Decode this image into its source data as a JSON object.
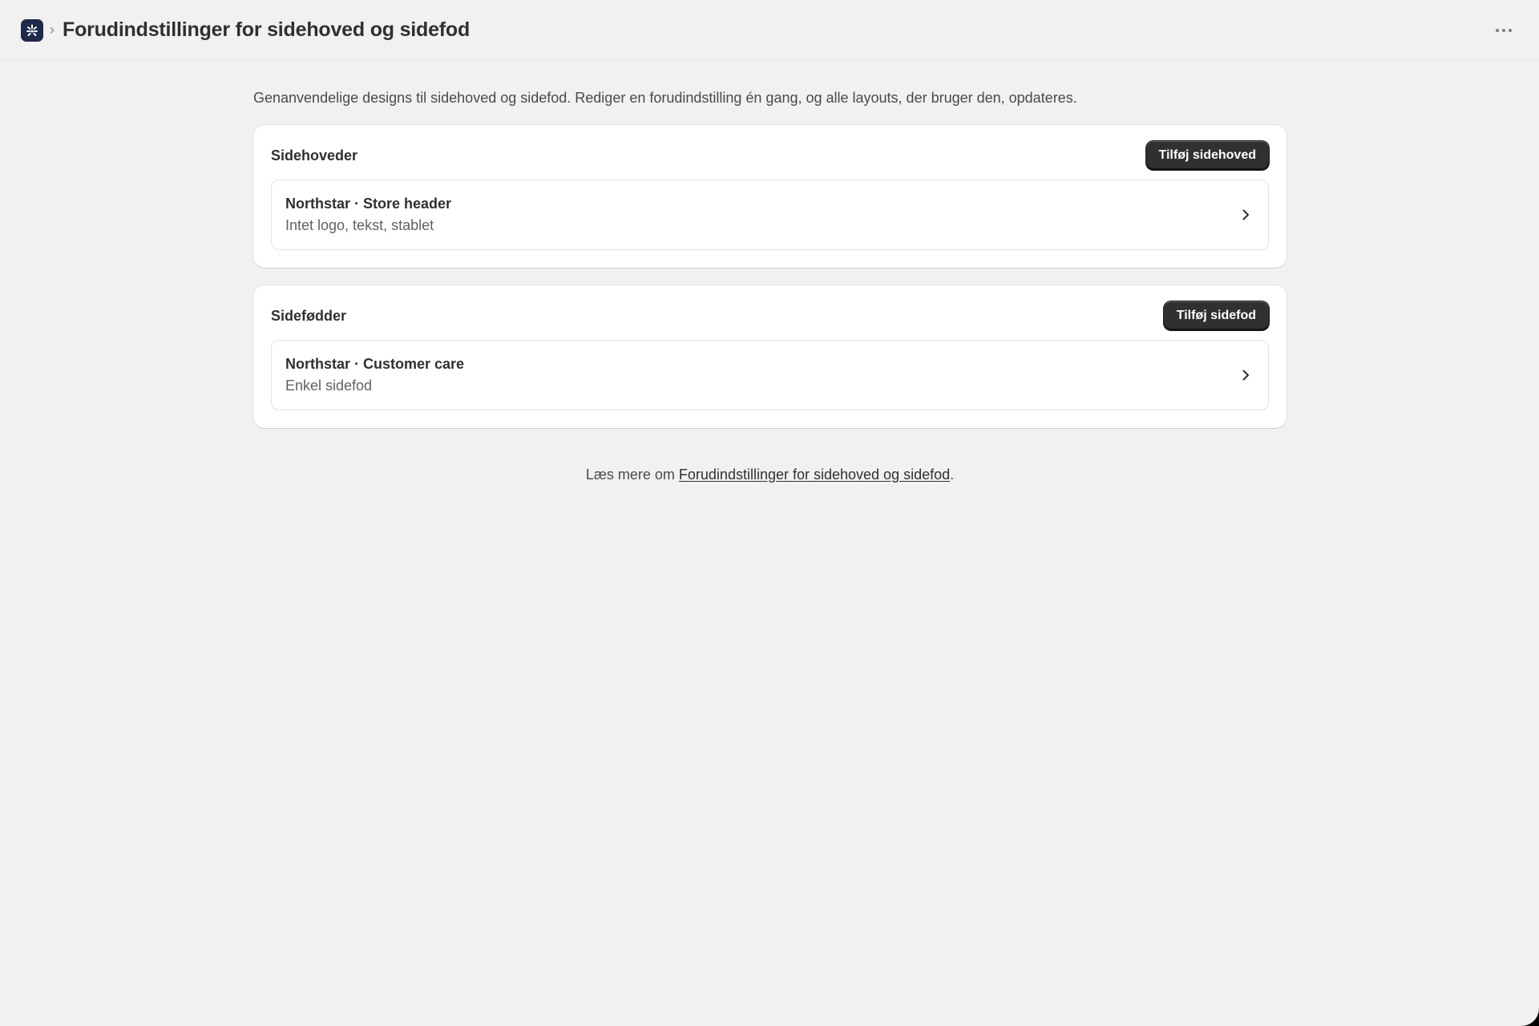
{
  "header": {
    "title": "Forudindstillinger for sidehoved og sidefod",
    "breadcrumb_separator": "›",
    "app_icon": "app-logo-icon",
    "more_icon": "more-horizontal-icon"
  },
  "main": {
    "description": "Genanvendelige designs til sidehoved og sidefod. Rediger en forudindstilling én gang, og alle layouts, der bruger den, opdateres.",
    "headers_section": {
      "title": "Sidehoveder",
      "add_button": "Tilføj sidehoved",
      "items": [
        {
          "name": "Northstar · Store header",
          "subtitle": "Intet logo, tekst, stablet"
        }
      ]
    },
    "footers_section": {
      "title": "Sidefødder",
      "add_button": "Tilføj sidefod",
      "items": [
        {
          "name": "Northstar · Customer care",
          "subtitle": "Enkel sidefod"
        }
      ]
    },
    "help": {
      "prefix": "Læs mere om ",
      "link": "Forudindstillinger for sidehoved og sidefod",
      "suffix": "."
    }
  },
  "colors": {
    "background": "#f1f1f1",
    "card": "#ffffff",
    "primary_button": "#303030",
    "app_icon_bg": "#1f2a4a"
  }
}
